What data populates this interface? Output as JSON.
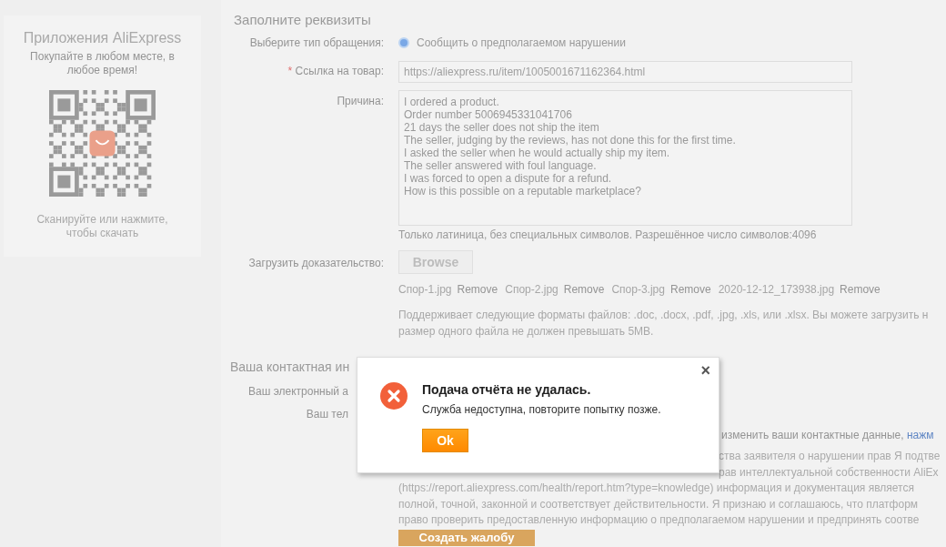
{
  "sidebar": {
    "title": "Приложения AliExpress",
    "subtitle": "Покупайте в любом месте, в любое время!",
    "caption": "Сканируйте или нажмите, чтобы скачать"
  },
  "form": {
    "title": "Заполните реквизиты",
    "type_label": "Выберите тип обращения:",
    "type_options": [
      {
        "label": "Сообщить о предполагаемом нарушении",
        "selected": true
      }
    ],
    "required_mark": "*",
    "link_label": "Ссылка на товар:",
    "link_value": "https://aliexpress.ru/item/1005001671162364.html",
    "reason_label": "Причина:",
    "reason_lines": [
      "I ordered a product.",
      "Order number 5006945331041706",
      "21 days the seller does not ship the item",
      "The seller, judging by the reviews, has not done this for the first time.",
      "I asked the seller when he would actually ship my item.",
      "The seller answered with foul language.",
      "I was forced to open a dispute for a refund.",
      "How is this possible on a reputable marketplace?"
    ],
    "reason_hint": "Только латиница, без специальных символов. Разрешённое число символов:4096",
    "upload_label": "Загрузить доказательство:",
    "browse": "Browse",
    "files": [
      {
        "name": "Спор-1.jpg",
        "remove": "Remove"
      },
      {
        "name": "Спор-2.jpg",
        "remove": "Remove"
      },
      {
        "name": "Спор-3.jpg",
        "remove": "Remove"
      },
      {
        "name": "2020-12-12_173938.jpg",
        "remove": "Remove"
      }
    ],
    "formats_lines": [
      "Поддерживает следующие форматы файлов: .doc, .docx, .pdf, .jpg, .xls, или .xlsx. Вы можете загрузить н",
      "размер одного файла не должен превышать 5MB."
    ]
  },
  "contact": {
    "title": "Ваша контактная ин",
    "email_label": "Ваш электронный а",
    "phone_label": "Ваш тел",
    "change_text": "изменить ваши контактные данные,",
    "change_link": "нажм",
    "declaration_partial": [
      "ства заявителя о нарушении прав Я подтве",
      "рав интеллектуальной собственности AliEx"
    ],
    "declaration_lines": [
      "(https://report.aliexpress.com/health/report.htm?type=knowledge) информация и документация является",
      "полной, точной, законной и соответствует действительности. Я признаю и соглашаюсь, что платформ",
      "право проверить предоставленную информацию о предполагаемом нарушении и предпринять соотве"
    ],
    "submit": "Создать жалобу",
    "submit_disabled": true
  },
  "dialog": {
    "title": "Подача отчёта не удалась.",
    "message": "Служба недоступна, повторите попытку позже.",
    "ok": "Ok",
    "close": "×"
  }
}
